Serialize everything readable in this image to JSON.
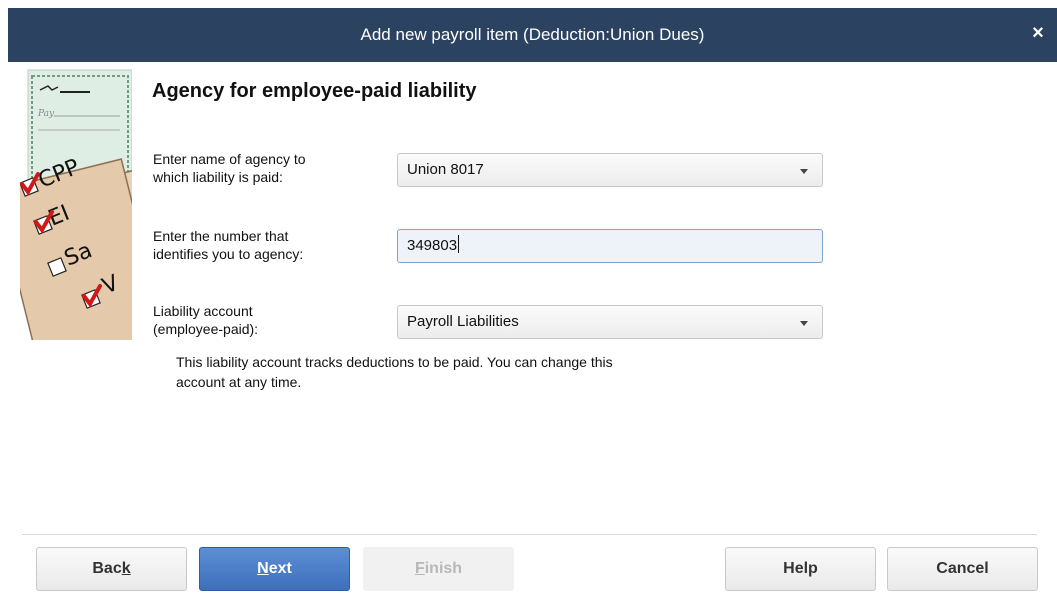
{
  "window": {
    "title": "Add new payroll item (Deduction:Union Dues)",
    "close_glyph": "×"
  },
  "illustration": {
    "icon": "payroll-checklist-illustration",
    "items": [
      "CPP",
      "EI",
      "Sa",
      "V"
    ]
  },
  "heading": "Agency for employee-paid liability",
  "form": {
    "agency_name": {
      "label_line1": "Enter name of agency to",
      "label_line2": "which liability is paid:",
      "value": "Union 8017"
    },
    "agency_number": {
      "label_line1": "Enter the number that",
      "label_line2": "identifies you to agency:",
      "value": "349803"
    },
    "liability_account": {
      "label_line1": "Liability account",
      "label_line2": "(employee-paid):",
      "value": "Payroll Liabilities"
    },
    "note_line1": "This liability account tracks deductions to be paid. You can change this",
    "note_line2": "account at any time."
  },
  "buttons": {
    "back_pre": "Bac",
    "back_key": "k",
    "next_key": "N",
    "next_post": "ext",
    "finish_key": "F",
    "finish_post": "inish",
    "help": "Help",
    "cancel": "Cancel"
  },
  "colors": {
    "titlebar": "#2b4260",
    "primary_button": "#4a7cc7"
  }
}
